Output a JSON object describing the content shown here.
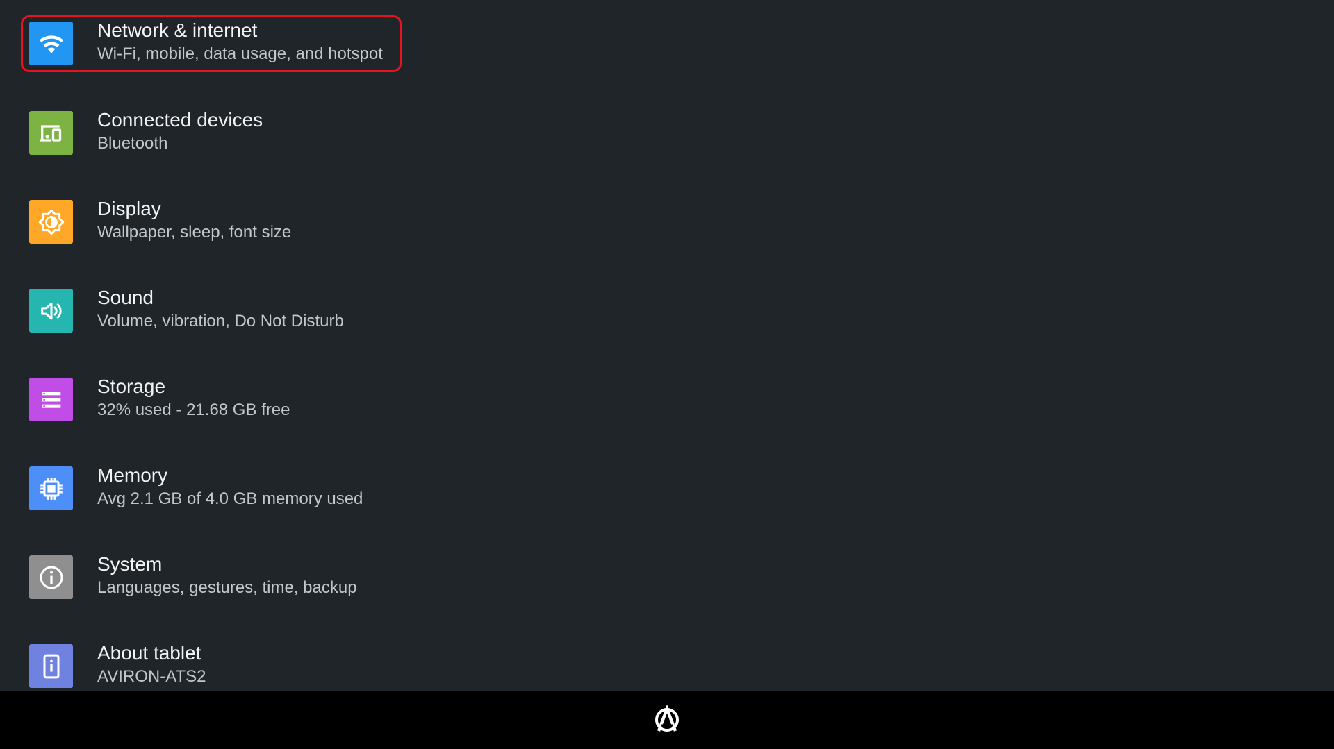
{
  "settings": {
    "items": [
      {
        "id": "network",
        "title": "Network & internet",
        "summary": "Wi-Fi, mobile, data usage, and hotspot",
        "icon": "wifi-icon",
        "color": "#2196f3",
        "selected": true
      },
      {
        "id": "connected",
        "title": "Connected devices",
        "summary": "Bluetooth",
        "icon": "devices-icon",
        "color": "#7cb342"
      },
      {
        "id": "display",
        "title": "Display",
        "summary": "Wallpaper, sleep, font size",
        "icon": "brightness-icon",
        "color": "#ffa726"
      },
      {
        "id": "sound",
        "title": "Sound",
        "summary": "Volume, vibration, Do Not Disturb",
        "icon": "volume-icon",
        "color": "#26b6b0"
      },
      {
        "id": "storage",
        "title": "Storage",
        "summary": "32% used - 21.68 GB free",
        "icon": "storage-icon",
        "color": "#c04ee6"
      },
      {
        "id": "memory",
        "title": "Memory",
        "summary": "Avg 2.1 GB of 4.0 GB memory used",
        "icon": "memory-chip-icon",
        "color": "#4e8ef7"
      },
      {
        "id": "system",
        "title": "System",
        "summary": "Languages, gestures, time, backup",
        "icon": "info-icon",
        "color": "#8f8f8f"
      },
      {
        "id": "about",
        "title": "About tablet",
        "summary": "AVIRON-ATS2",
        "icon": "phone-info-icon",
        "color": "#6f82e0"
      }
    ]
  },
  "nav_bar": {
    "logo_icon": "aviron-logo-icon",
    "background": "#000000"
  },
  "theme": {
    "background": "#202529",
    "selection_outline": "#e5141f"
  }
}
